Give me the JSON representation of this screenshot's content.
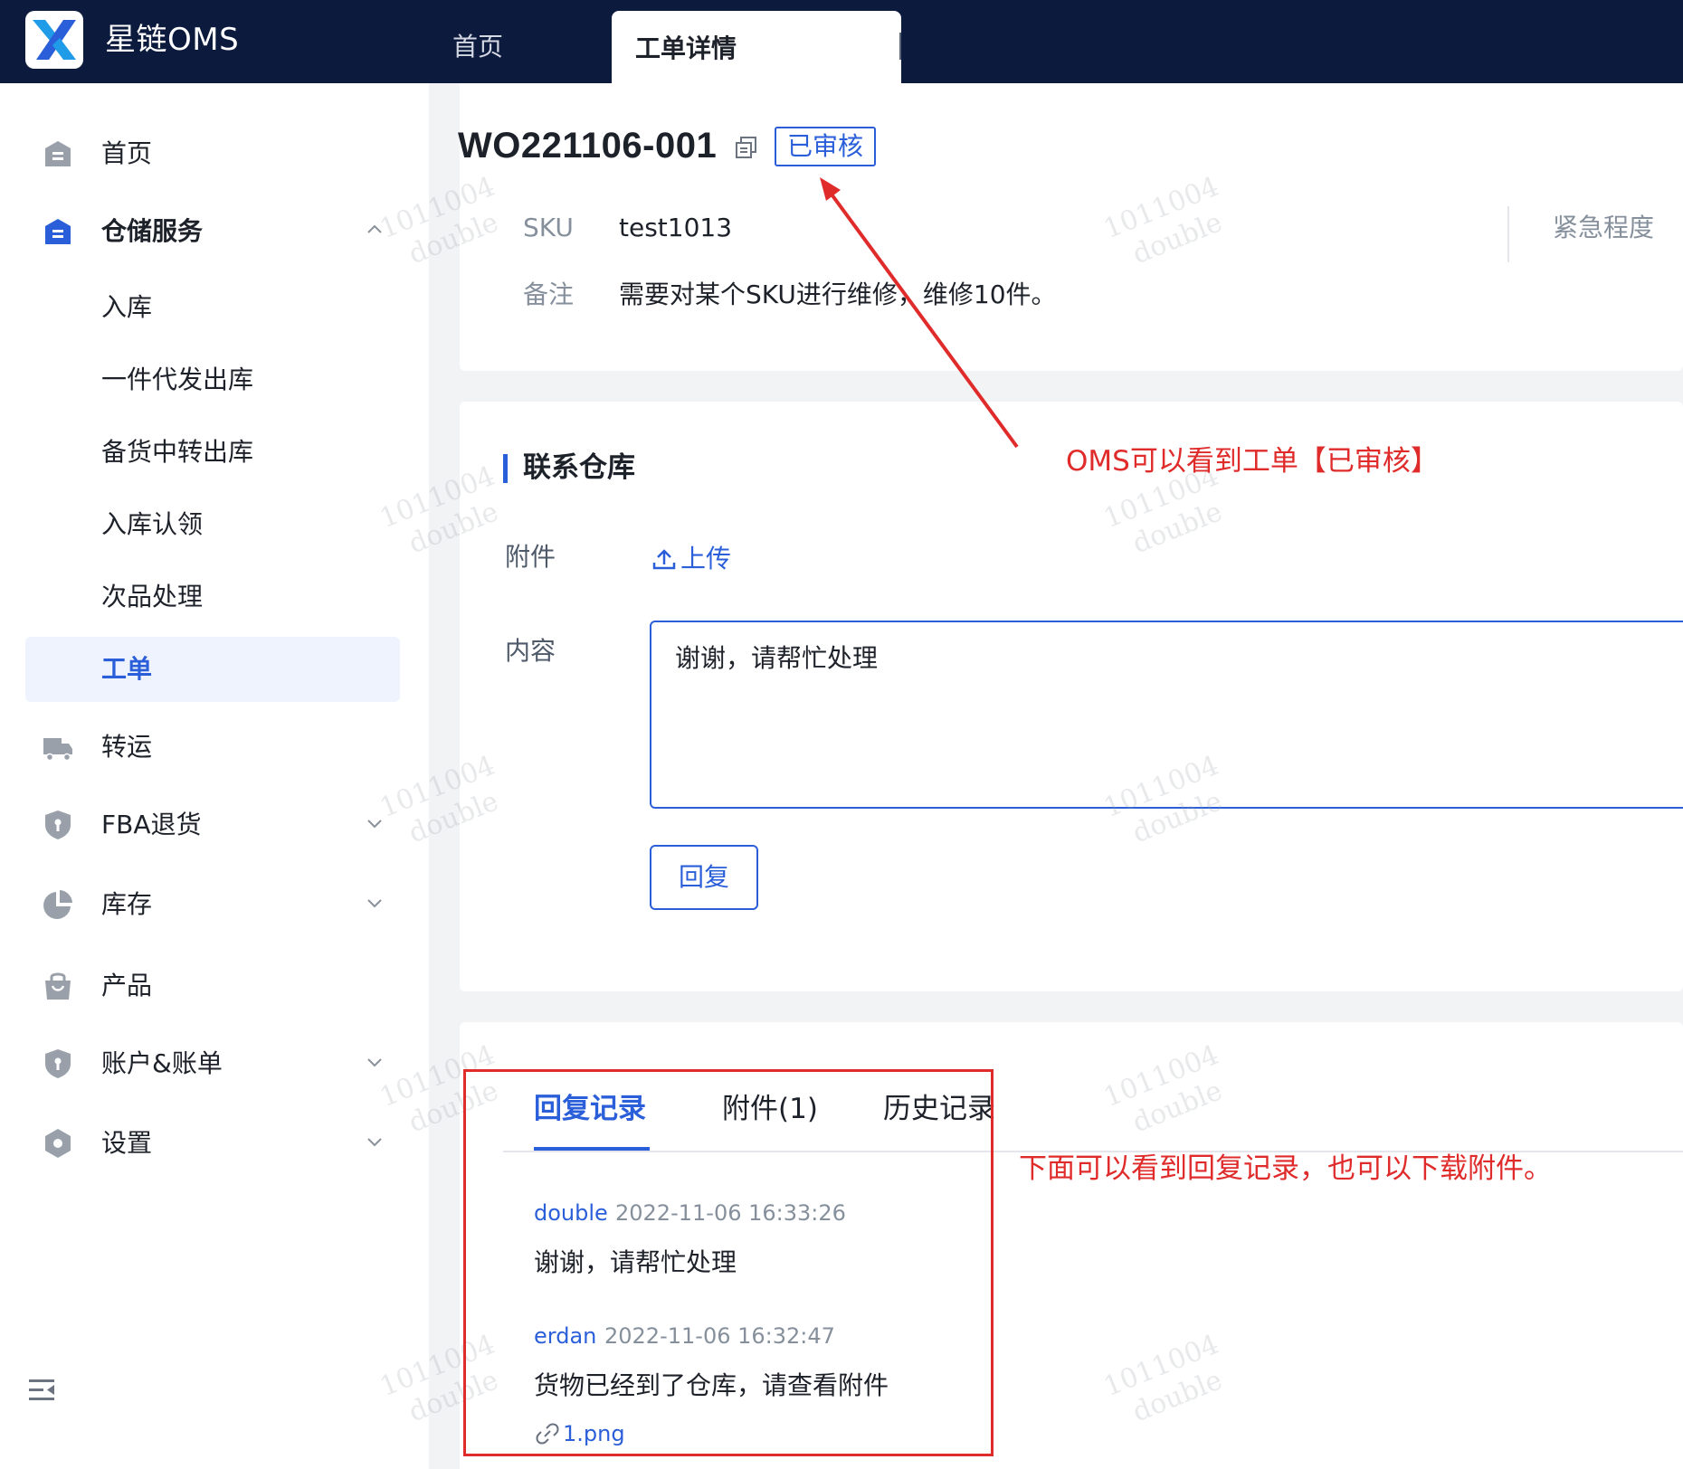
{
  "header": {
    "app_title": "星链OMS",
    "tabs": [
      {
        "label": "首页"
      },
      {
        "label": "工单详情"
      }
    ]
  },
  "sidebar": {
    "items": [
      {
        "label": "首页",
        "icon": "home-icon"
      },
      {
        "label": "仓储服务",
        "icon": "warehouse-icon",
        "expanded": true
      },
      {
        "label": "转运",
        "icon": "truck-icon"
      },
      {
        "label": "FBA退货",
        "icon": "shield-icon"
      },
      {
        "label": "库存",
        "icon": "pie-chart-icon"
      },
      {
        "label": "产品",
        "icon": "bag-icon"
      },
      {
        "label": "账户&账单",
        "icon": "shield-icon"
      },
      {
        "label": "设置",
        "icon": "hexagon-icon"
      }
    ],
    "sub_items": [
      {
        "label": "入库"
      },
      {
        "label": "一件代发出库"
      },
      {
        "label": "备货中转出库"
      },
      {
        "label": "入库认领"
      },
      {
        "label": "次品处理"
      },
      {
        "label": "工单",
        "active": true
      }
    ]
  },
  "detail": {
    "work_order_id": "WO221106-001",
    "status": "已审核",
    "sku_label": "SKU",
    "sku_value": "test1013",
    "note_label": "备注",
    "note_value": "需要对某个SKU进行维修，维修10件。",
    "urgency_label": "紧急程度"
  },
  "contact": {
    "section_title": "联系仓库",
    "attachment_label": "附件",
    "upload_label": "上传",
    "content_label": "内容",
    "content_value": "谢谢，请帮忙处理",
    "reply_button": "回复"
  },
  "records": {
    "tabs": [
      {
        "label": "回复记录",
        "active": true
      },
      {
        "label": "附件(1)"
      },
      {
        "label": "历史记录"
      }
    ],
    "items": [
      {
        "user": "double",
        "time": "2022-11-06 16:33:26",
        "text": "谢谢，请帮忙处理"
      },
      {
        "user": "erdan",
        "time": "2022-11-06 16:32:47",
        "text": "货物已经到了仓库，请查看附件",
        "attachment": "1.png"
      }
    ]
  },
  "annotations": {
    "status_note": "OMS可以看到工单【已审核】",
    "records_note": "下面可以看到回复记录，也可以下载附件。"
  },
  "watermark": {
    "line1": "1011004",
    "line2": "double"
  },
  "colors": {
    "topbar": "#0c1a3d",
    "accent": "#2b5fd9",
    "annotation": "#e02b2b"
  }
}
